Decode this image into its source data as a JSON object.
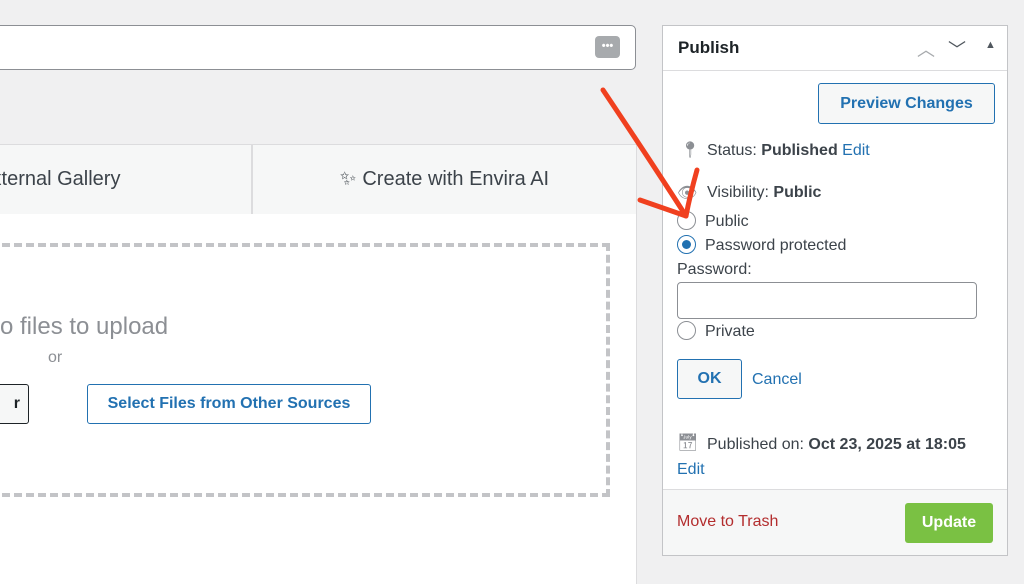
{
  "editor": {
    "more_icon": "ellipsis-icon"
  },
  "tabs": [
    {
      "label": "xternal Gallery"
    },
    {
      "label": "Create with Envira AI",
      "icon": "sparkles-icon"
    }
  ],
  "upload": {
    "drop_text": "o files to upload",
    "or": "or",
    "partial_button": "r",
    "other_sources_button": "Select Files from Other Sources"
  },
  "publish": {
    "title": "Publish",
    "preview_button": "Preview Changes",
    "status_label": "Status:",
    "status_value": "Published",
    "status_edit": "Edit",
    "visibility_label": "Visibility:",
    "visibility_value": "Public",
    "options": [
      {
        "label": "Public",
        "checked": false
      },
      {
        "label": "Password protected",
        "checked": true
      },
      {
        "label": "Private",
        "checked": false
      }
    ],
    "password_label": "Password:",
    "password_value": "",
    "ok_button": "OK",
    "cancel_link": "Cancel",
    "published_label": "Published on:",
    "published_value": "Oct 23, 2025 at 18:05",
    "published_edit": "Edit",
    "trash_link": "Move to Trash",
    "update_button": "Update"
  },
  "colors": {
    "accent": "#2271b1",
    "update": "#7ac143",
    "trash": "#b32d2e",
    "annotation_arrow": "#f0401f"
  }
}
